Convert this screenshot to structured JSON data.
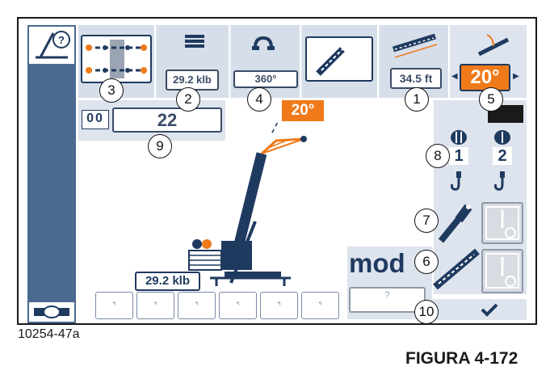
{
  "header": {
    "counterweight_value": "29.2 klb",
    "slew_value": "360°",
    "boom_length_value": "34.5 ft",
    "jib_angle_value": "20°"
  },
  "config": {
    "reeving_code": "00",
    "reeving_value": "22"
  },
  "view": {
    "jib_offset_label": "20°",
    "counterweight_label": "29.2 klb"
  },
  "winches": {
    "winch1_label": "1",
    "winch2_label": "2"
  },
  "mode": {
    "label": "mod",
    "button_text": "?"
  },
  "bottom_buttons": [
    "↰",
    "↰",
    "↰",
    "↰",
    "↰",
    "↰"
  ],
  "callouts": [
    "1",
    "2",
    "3",
    "4",
    "5",
    "6",
    "7",
    "8",
    "9",
    "10"
  ],
  "figure": {
    "image_id": "10254-47a",
    "caption": "FIGURA 4-172"
  },
  "colors": {
    "accent_orange": "#f07a1a",
    "navy": "#1f3a5f",
    "panel_blue": "#dde4ee"
  }
}
